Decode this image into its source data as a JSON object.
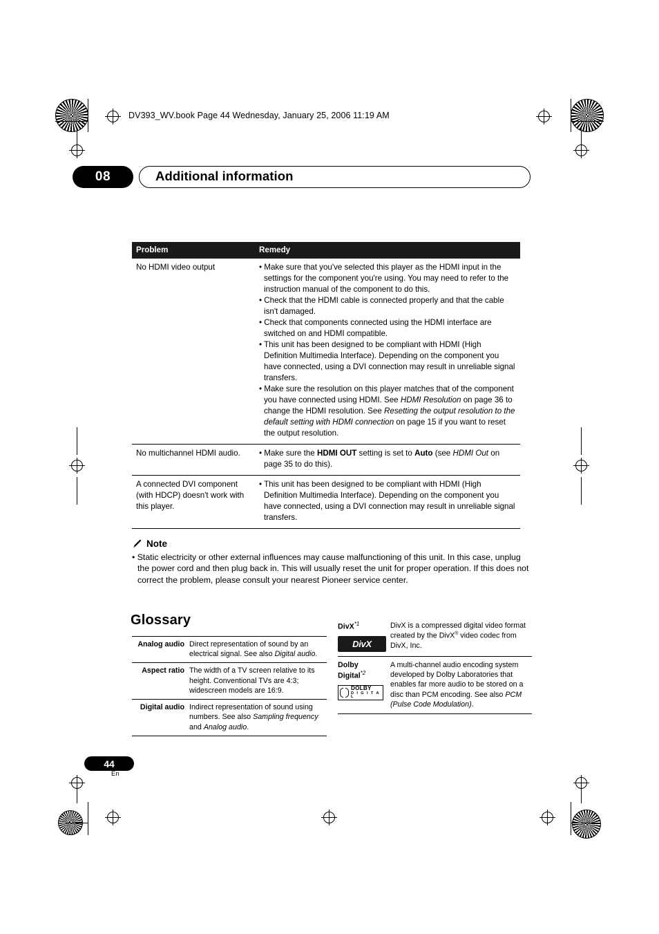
{
  "header": {
    "filename_line": "DV393_WV.book  Page 44  Wednesday, January 25, 2006  11:19 AM"
  },
  "chapter": {
    "number": "08",
    "title": "Additional information"
  },
  "troubleshooting": {
    "columns": [
      "Problem",
      "Remedy"
    ],
    "rows": [
      {
        "problem": "No HDMI video output",
        "remedies": [
          "• Make sure that you've selected this player as the HDMI input in the settings for the component you're using. You may need to refer to the instruction manual of the component to do this.",
          "• Check that the HDMI cable is connected properly and that the cable isn't damaged.",
          "• Check that components connected using the HDMI interface are switched on and HDMI compatible.",
          "• This unit has been designed to be compliant with HDMI (High Definition Multimedia Interface). Depending on the component you have connected, using a DVI connection may result in unreliable signal transfers.",
          "• Make sure the resolution on this player matches that of the component you have connected using HDMI. See HDMI Resolution on page 36 to change the HDMI resolution. See Resetting the output resolution to the default setting with HDMI connection on page 15 if you want to reset the output resolution."
        ]
      },
      {
        "problem": "No multichannel HDMI audio.",
        "remedies": [
          "• Make sure the HDMI OUT setting is set to Auto (see HDMI Out on page 35 to do this)."
        ]
      },
      {
        "problem": "A connected DVI component (with HDCP) doesn't work with this player.",
        "remedies": [
          "• This unit has been designed to be compliant with HDMI (High Definition Multimedia Interface). Depending on the component you have connected, using a DVI connection may result in unreliable signal transfers."
        ]
      }
    ]
  },
  "note": {
    "heading": "Note",
    "icon": "pencil-icon",
    "body": "• Static electricity or other external influences may cause malfunctioning of this unit. In this case, unplug the power cord and then plug back in. This will usually reset the unit for proper operation. If this does not correct the problem, please consult your nearest Pioneer service center."
  },
  "glossary": {
    "title": "Glossary",
    "left_entries": [
      {
        "term": "Analog audio",
        "definition": "Direct representation of sound by an electrical signal. See also Digital audio."
      },
      {
        "term": "Aspect ratio",
        "definition": "The width of a TV screen relative to its height. Conventional TVs are 4:3; widescreen models are 16:9."
      },
      {
        "term": "Digital audio",
        "definition": "Indirect representation of sound using numbers. See also Sampling frequency and Analog audio."
      }
    ],
    "right_entries": [
      {
        "term": "DivX",
        "term_sup": "*1",
        "definition": "DivX is a compressed digital video format created by the DivX® video codec from DivX, Inc.",
        "logo": "divx-logo",
        "logo_text": "DivX"
      },
      {
        "term": "Dolby Digital",
        "term_sup": "*2",
        "definition": "A multi-channel audio encoding system developed by Dolby Laboratories that enables far more audio to be stored on a disc than PCM encoding. See also PCM (Pulse Code Modulation).",
        "logo": "dolby-digital-logo",
        "logo_text": "DOLBY",
        "logo_subtext": "D I G I T A L"
      }
    ]
  },
  "footer": {
    "page_number": "44",
    "language_code": "En"
  }
}
